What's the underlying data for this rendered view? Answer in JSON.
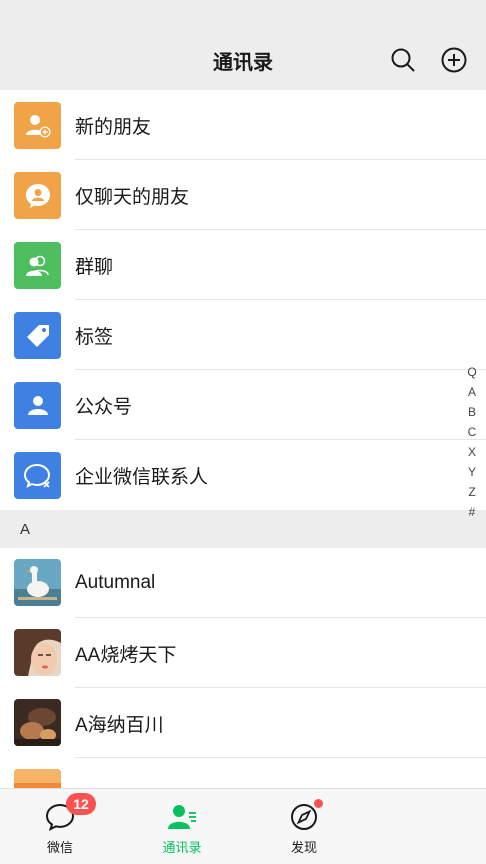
{
  "header": {
    "title": "通讯录",
    "search_icon": "search-icon",
    "add_icon": "plus-circle-icon"
  },
  "functions": [
    {
      "label": "新的朋友",
      "icon": "add-friend-icon",
      "color": "#f0a347"
    },
    {
      "label": "仅聊天的朋友",
      "icon": "chat-only-friend-icon",
      "color": "#f0a347"
    },
    {
      "label": "群聊",
      "icon": "group-chat-icon",
      "color": "#4fbe5e"
    },
    {
      "label": "标签",
      "icon": "tag-icon",
      "color": "#3f81e3"
    },
    {
      "label": "公众号",
      "icon": "official-account-icon",
      "color": "#3f81e3"
    },
    {
      "label": "企业微信联系人",
      "icon": "work-wechat-icon",
      "color": "#3f81e3"
    }
  ],
  "section_a": "A",
  "contacts": [
    {
      "name": "Autumnal"
    },
    {
      "name": "AA烧烤天下"
    },
    {
      "name": "A海纳百川"
    }
  ],
  "index": [
    "Q",
    "A",
    "B",
    "C",
    "X",
    "Y",
    "Z",
    "#"
  ],
  "tabbar": {
    "chats": {
      "label": "微信",
      "badge": "12"
    },
    "contacts": {
      "label": "通讯录"
    },
    "discover": {
      "label": "发现"
    }
  },
  "colors": {
    "accent": "#07c160",
    "badge": "#fa5151"
  }
}
